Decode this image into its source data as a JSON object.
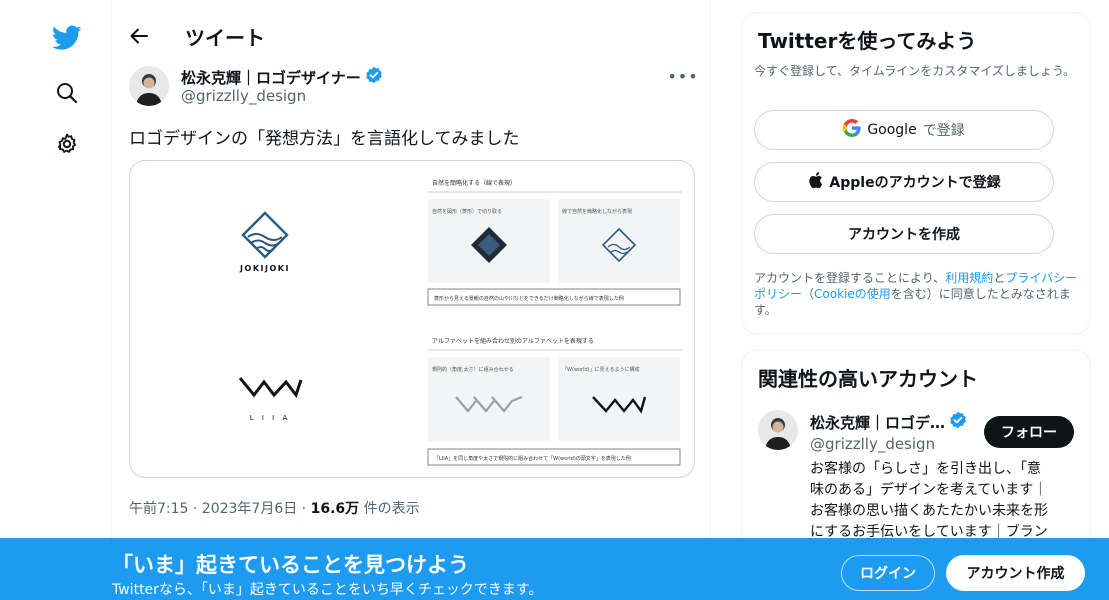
{
  "nav": {
    "items": [
      {
        "name": "twitter-logo-icon"
      },
      {
        "name": "search-icon"
      },
      {
        "name": "gear-icon"
      }
    ]
  },
  "header": {
    "title": "ツイート"
  },
  "tweet": {
    "author_name": "松永克輝｜ロゴデザイナー",
    "author_handle": "@grizzlly_design",
    "text": "ロゴデザインの「発想方法」を言語化してみました",
    "time": "午前7:15 · 2023年7月6日 · ",
    "views": "16.6万",
    "views_suffix": " 件の表示",
    "media": {
      "logo1_text": "JOKIJOKI",
      "logo2_text": "L I I A",
      "section1_title": "自然を簡略化する（線で表現）",
      "panel1_caption": "自然を図形（菱形）で切り取る",
      "panel2_caption": "線で自然を簡略化しながら表現",
      "panel1_note": "",
      "section1_footer": "菱形から見える景観の自然の山や川などをできるだけ簡略化しながら線で表現した例",
      "section2_title": "アルファベットを組み合わせ別のアルファベットを表現する",
      "panel3_caption": "規則的（角度,太さ）に組み合わせる",
      "panel4_caption": "「W(world)」に見えるように構成",
      "section2_footer": "「LIIA」を同じ角度や太さで規則的に組み合わせて「W(world)の頭文字」を表現した例"
    }
  },
  "signup_card": {
    "title": "Twitterを使ってみよう",
    "subtitle": "今すぐ登録して、タイムラインをカスタマイズしましょう。",
    "google_label": "Google",
    "google_suffix": "で登録",
    "apple_label": "Appleのアカウントで登録",
    "create_label": "アカウントを作成",
    "terms_prefix": "アカウントを登録することにより、",
    "terms_link": "利用規約",
    "terms_and": "と",
    "privacy_link": "プライバシーポリシー",
    "terms_paren_open": "（",
    "cookie_link": "Cookieの使用",
    "terms_suffix": "を含む）に同意したとみなされます。"
  },
  "related_card": {
    "title": "関連性の高いアカウント",
    "name": "松永克輝｜ロゴデ…",
    "handle": "@grizzlly_design",
    "follow_label": "フォロー",
    "bio_lines": [
      "お客様の「らしさ」を引き出し、「意",
      "味のある」デザインを考えています｜",
      "お客様の思い描くあたたかい未来を形",
      "にするお手伝いをしています｜ブラン"
    ]
  },
  "bottom_bar": {
    "title": "「いま」起きていることを見つけよう",
    "subtitle": "Twitterなら、「いま」起きていることをいち早くチェックできます。",
    "login_label": "ログイン",
    "signup_label": "アカウント作成"
  },
  "colors": {
    "brand": "#1d9bf0",
    "text": "#0f1419",
    "muted": "#536471",
    "logo_blue": "#2b5a82"
  }
}
